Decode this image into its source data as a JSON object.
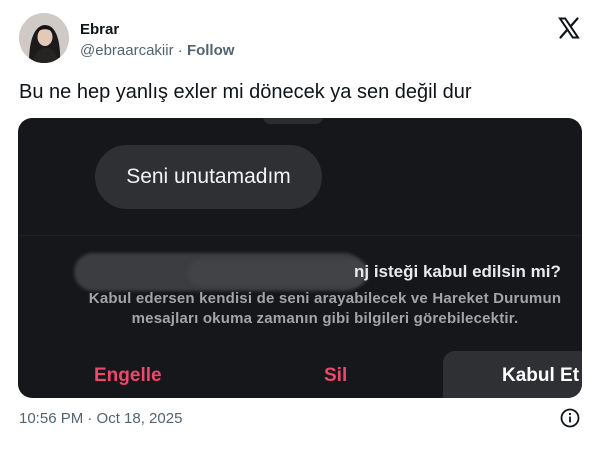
{
  "author": {
    "display_name": "Ebrar",
    "handle": "@ebraarcakiir",
    "separator": "·",
    "follow_label": "Follow",
    "avatar_icon": "avatar-photo"
  },
  "brand": {
    "logo_icon": "x-logo-icon"
  },
  "tweet": {
    "text": "Bu ne hep yanlış exler mi dönecek ya sen değil dur",
    "timestamp": "10:56 PM · Oct 18, 2025"
  },
  "media": {
    "message_bubble": "Seni unutamadım",
    "request_title": "nj isteği kabul edilsin mi?",
    "request_desc_line1": "Kabul edersen kendisi de seni arayabilecek ve Hareket Durumun",
    "request_desc_line2": "mesajları okuma zamanın gibi bilgileri görebilecektir.",
    "block_label": "Engelle",
    "delete_label": "Sil",
    "accept_label": "Kabul Et",
    "accent_color": "#f0466b"
  },
  "footer": {
    "info_icon": "info-icon"
  }
}
